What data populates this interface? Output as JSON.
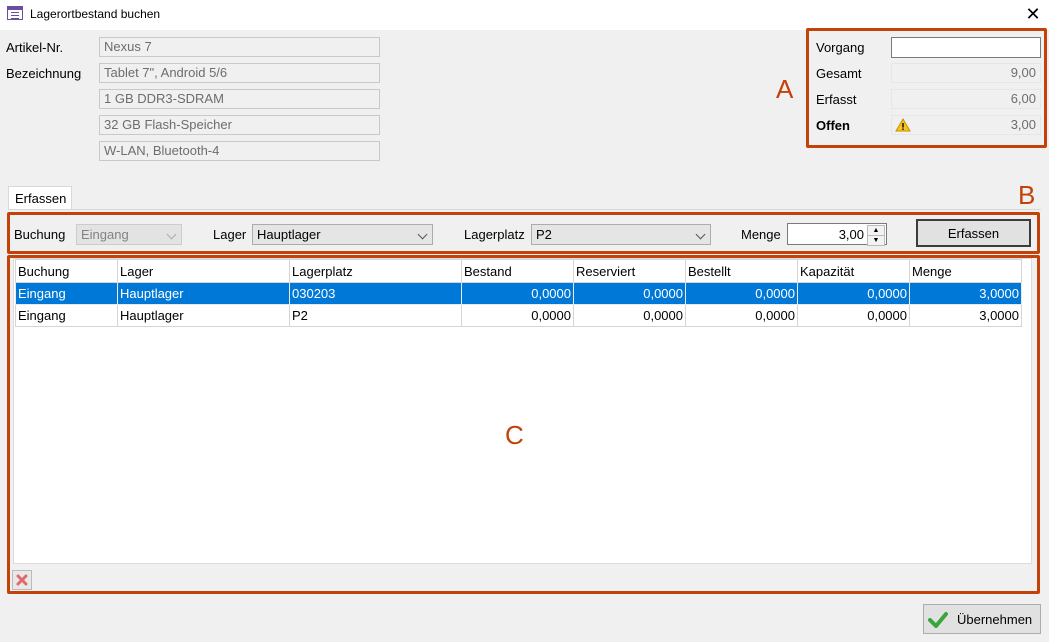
{
  "window": {
    "title": "Lagerortbestand buchen"
  },
  "article": {
    "artikel_label": "Artikel-Nr.",
    "artikel_value": "Nexus 7",
    "bez_label": "Bezeichnung",
    "bez_lines": [
      "Tablet 7\", Android 5/6",
      "1 GB DDR3-SDRAM",
      "32 GB Flash-Speicher",
      "W-LAN, Bluetooth-4"
    ]
  },
  "summary": {
    "vorgang_label": "Vorgang",
    "vorgang_value": "",
    "gesamt_label": "Gesamt",
    "gesamt_value": "9,00",
    "erfasst_label": "Erfasst",
    "erfasst_value": "6,00",
    "offen_label": "Offen",
    "offen_value": "3,00"
  },
  "annotations": {
    "a": "A",
    "b": "B",
    "c": "C"
  },
  "tab": {
    "label": "Erfassen"
  },
  "form": {
    "buchung_label": "Buchung",
    "buchung_value": "Eingang",
    "lager_label": "Lager",
    "lager_value": "Hauptlager",
    "lagerplatz_label": "Lagerplatz",
    "lagerplatz_value": "P2",
    "menge_label": "Menge",
    "menge_value": "3,00",
    "erfassen_button": "Erfassen"
  },
  "table": {
    "headers": [
      "Buchung",
      "Lager",
      "Lagerplatz",
      "Bestand",
      "Reserviert",
      "Bestellt",
      "Kapazität",
      "Menge"
    ],
    "rows": [
      [
        "Eingang",
        "Hauptlager",
        "030203",
        "0,0000",
        "0,0000",
        "0,0000",
        "0,0000",
        "3,0000"
      ],
      [
        "Eingang",
        "Hauptlager",
        "P2",
        "0,0000",
        "0,0000",
        "0,0000",
        "0,0000",
        "3,0000"
      ]
    ],
    "selected_row": 0
  },
  "footer": {
    "ok_button": "Übernehmen"
  },
  "colors": {
    "annotation": "#c2420a",
    "selection": "#0078d7",
    "check": "#3aa53a"
  }
}
